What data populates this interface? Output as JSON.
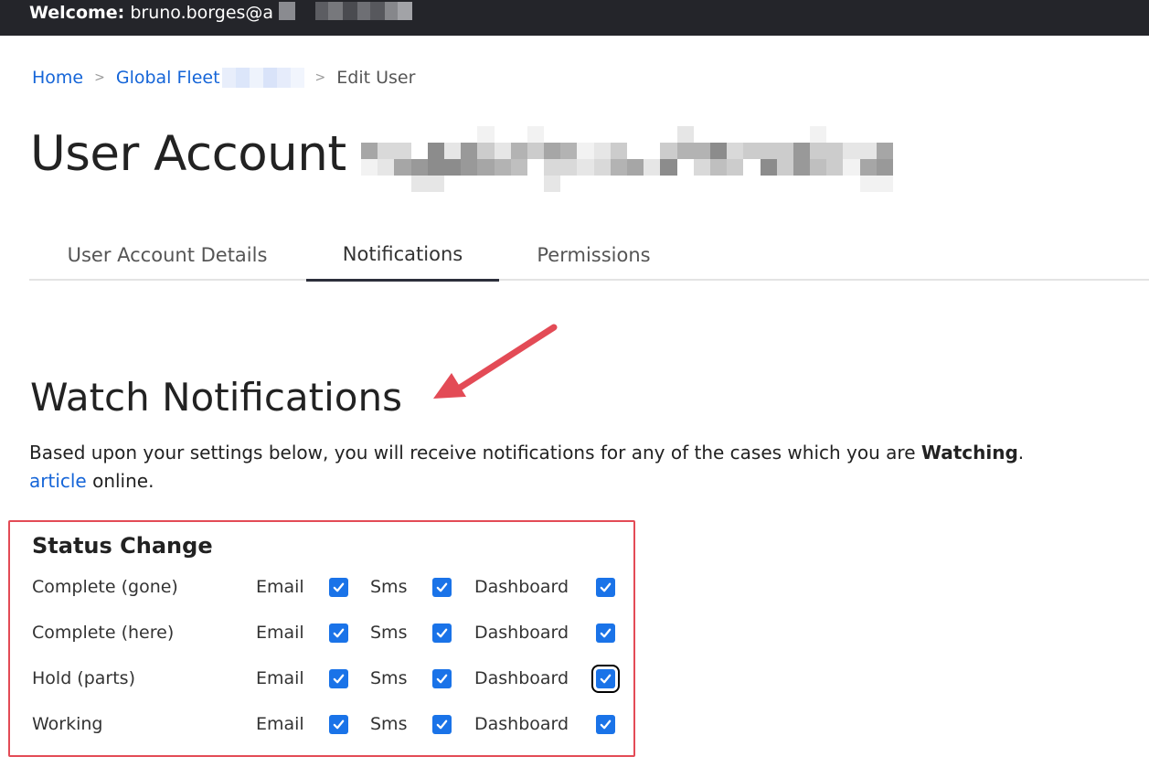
{
  "header": {
    "welcome_label": "Welcome:",
    "user_visible": "bruno.borges@a"
  },
  "breadcrumb": {
    "home": "Home",
    "sep": ">",
    "fleet": "Global Fleet",
    "current": "Edit User"
  },
  "page": {
    "title": "User Account"
  },
  "tabs": [
    {
      "label": "User Account Details"
    },
    {
      "label": "Notifications"
    },
    {
      "label": "Permissions"
    }
  ],
  "active_tab": "Notifications",
  "section": {
    "title": "Watch Notifications",
    "desc_prefix": "Based upon your settings below, you will receive notifications for any of the cases which you are ",
    "desc_bold": "Watching",
    "desc_suffix": ".",
    "desc_link": "article",
    "desc_line2_suffix": " online."
  },
  "status_change": {
    "title": "Status Change",
    "channels": [
      "Email",
      "Sms",
      "Dashboard"
    ],
    "rows": [
      {
        "label": "Complete (gone)",
        "email": true,
        "sms": true,
        "dashboard": true
      },
      {
        "label": "Complete (here)",
        "email": true,
        "sms": true,
        "dashboard": true
      },
      {
        "label": "Hold (parts)",
        "email": true,
        "sms": true,
        "dashboard": true
      },
      {
        "label": "Working",
        "email": true,
        "sms": true,
        "dashboard": true
      }
    ]
  },
  "colors": {
    "accent": "#1a73e8",
    "link": "#1565d8",
    "annotation": "#e34b56",
    "topbar": "#24252a"
  },
  "icons": [
    "check-icon",
    "annotation-arrow"
  ]
}
